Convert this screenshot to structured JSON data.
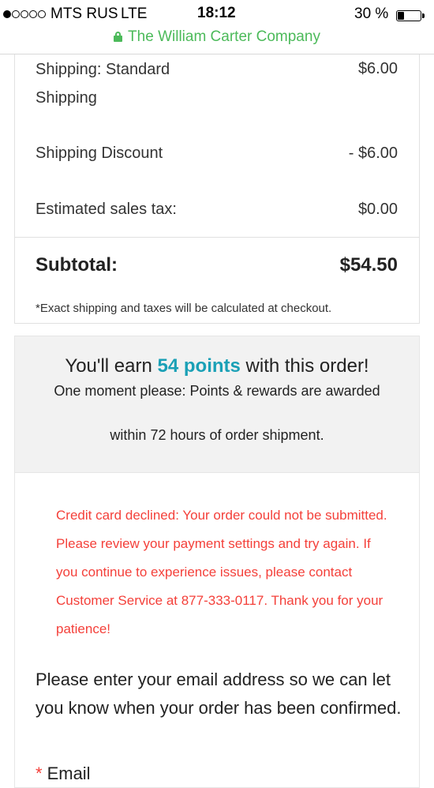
{
  "status_bar": {
    "carrier": "MTS RUS",
    "network": "LTE",
    "time": "18:12",
    "battery_percent": "30 %",
    "battery_level": 0.3,
    "signal_bars_filled": 1,
    "signal_bars_total": 5
  },
  "browser": {
    "site_name": "The William Carter Company",
    "secure_icon": "lock-icon"
  },
  "order_summary": {
    "shipping_label_line1": "Shipping: Standard",
    "shipping_label_line2": "Shipping",
    "shipping_amount": "$6.00",
    "discount_label": "Shipping Discount",
    "discount_amount": "- $6.00",
    "tax_label": "Estimated sales tax:",
    "tax_amount": "$0.00",
    "subtotal_label": "Subtotal:",
    "subtotal_amount": "$54.50",
    "note": "*Exact shipping and taxes will be calculated at checkout."
  },
  "rewards": {
    "earn_prefix": "You'll earn ",
    "points": "54 points",
    "earn_suffix": " with this order!",
    "line2": "One moment please: Points & rewards are awarded",
    "line3": "within 72 hours of order shipment."
  },
  "error_message": "Credit card declined: Your order could not be submitted. Please review your payment settings and try again. If you continue to experience issues, please contact Customer Service at 877-333-0117. Thank you for your patience!",
  "email_section": {
    "prompt": "Please enter your email address so we can let you know when your order has been confirmed.",
    "required_marker": "*",
    "field_label": "Email"
  },
  "colors": {
    "secure_green": "#4cba5a",
    "points_teal": "#1aa0b6",
    "error_red": "#f4403a"
  }
}
